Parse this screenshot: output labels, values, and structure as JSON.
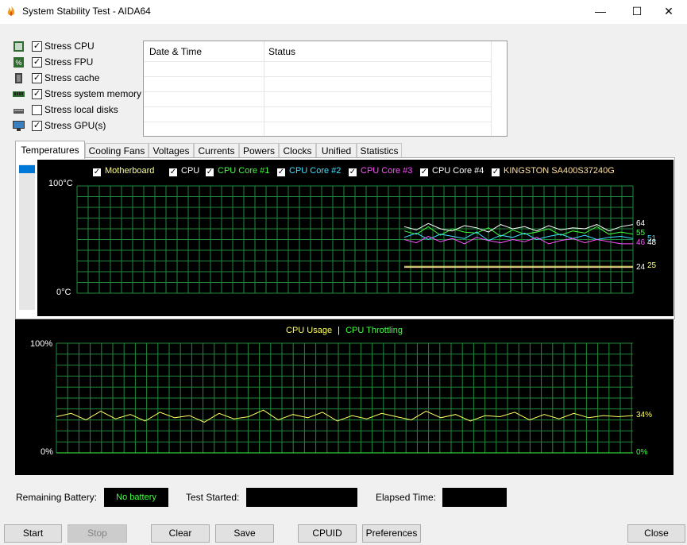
{
  "window": {
    "title": "System Stability Test - AIDA64",
    "minimize": "—",
    "maximize": "☐",
    "close": "✕"
  },
  "stress_options": [
    {
      "label": "Stress CPU",
      "checked": true,
      "icon": "cpu-chip-icon"
    },
    {
      "label": "Stress FPU",
      "checked": true,
      "icon": "fpu-icon"
    },
    {
      "label": "Stress cache",
      "checked": true,
      "icon": "cache-icon"
    },
    {
      "label": "Stress system memory",
      "checked": true,
      "icon": "memory-icon"
    },
    {
      "label": "Stress local disks",
      "checked": false,
      "icon": "disk-icon"
    },
    {
      "label": "Stress GPU(s)",
      "checked": true,
      "icon": "monitor-icon"
    }
  ],
  "log": {
    "col_date": "Date & Time",
    "col_status": "Status",
    "rows": []
  },
  "tabs": [
    "Temperatures",
    "Cooling Fans",
    "Voltages",
    "Currents",
    "Powers",
    "Clocks",
    "Unified",
    "Statistics"
  ],
  "active_tab": "Temperatures",
  "temperature_graph": {
    "legend": [
      {
        "label": "Motherboard",
        "color": "#ffff80",
        "checked": true
      },
      {
        "label": "CPU",
        "color": "#ffffff",
        "checked": true
      },
      {
        "label": "CPU Core #1",
        "color": "#40ff40",
        "checked": true
      },
      {
        "label": "CPU Core #2",
        "color": "#40e0ff",
        "checked": true
      },
      {
        "label": "CPU Core #3",
        "color": "#ff50ff",
        "checked": true
      },
      {
        "label": "CPU Core #4",
        "color": "#ffffff",
        "checked": true
      },
      {
        "label": "KINGSTON SA400S37240G",
        "color": "#ffe0a0",
        "checked": true
      }
    ],
    "y_max_label": "100°C",
    "y_min_label": "0°C",
    "current_values": [
      {
        "text": "64",
        "color": "#ffffff"
      },
      {
        "text": "55",
        "color": "#40ff40"
      },
      {
        "text": "51",
        "color": "#40e0ff"
      },
      {
        "text": "48",
        "color": "#ffffff"
      },
      {
        "text": "46",
        "color": "#ff50ff"
      },
      {
        "text": "24",
        "color": "#ffffff"
      },
      {
        "text": "25",
        "color": "#ffff80"
      }
    ]
  },
  "cpu_graph": {
    "title_usage": "CPU Usage",
    "separator": "|",
    "title_throttling": "CPU Throttling",
    "usage_color": "#ffff60",
    "throttling_color": "#40ff40",
    "y_max_label": "100%",
    "y_min_label": "0%",
    "current_usage": "34%",
    "current_throttling": "0%"
  },
  "chart_data": [
    {
      "type": "line",
      "title": "Temperatures",
      "ylim": [
        0,
        100
      ],
      "unit": "°C",
      "series": [
        {
          "name": "CPU Core #1",
          "values": [
            58,
            55,
            62,
            54,
            60,
            57,
            56,
            61,
            53,
            59,
            55,
            57,
            60,
            54,
            58,
            56,
            62,
            55,
            57,
            55
          ]
        },
        {
          "name": "CPU Core #2",
          "values": [
            52,
            56,
            50,
            55,
            53,
            51,
            57,
            49,
            54,
            52,
            56,
            50,
            53,
            55,
            51,
            54,
            50,
            52,
            53,
            51
          ]
        },
        {
          "name": "CPU Core #3",
          "values": [
            50,
            47,
            53,
            48,
            51,
            46,
            52,
            49,
            47,
            50,
            48,
            52,
            46,
            49,
            51,
            47,
            50,
            48,
            46,
            46
          ]
        },
        {
          "name": "CPU",
          "values": [
            62,
            59,
            65,
            60,
            58,
            63,
            61,
            57,
            64,
            60,
            62,
            58,
            63,
            59,
            61,
            60,
            64,
            58,
            62,
            64
          ]
        },
        {
          "name": "Motherboard",
          "values": [
            25,
            25,
            25,
            25,
            25,
            25,
            25,
            25,
            25,
            25,
            25,
            25,
            25,
            25,
            25,
            25,
            25,
            25,
            25,
            25
          ]
        },
        {
          "name": "KINGSTON SA400S37240G",
          "values": [
            24,
            24,
            24,
            24,
            24,
            24,
            24,
            24,
            24,
            24,
            24,
            24,
            24,
            24,
            24,
            24,
            24,
            24,
            24,
            24
          ]
        }
      ]
    },
    {
      "type": "line",
      "title": "CPU Usage | CPU Throttling",
      "ylim": [
        0,
        100
      ],
      "unit": "%",
      "series": [
        {
          "name": "CPU Usage",
          "values": [
            33,
            36,
            30,
            38,
            31,
            35,
            29,
            37,
            32,
            34,
            28,
            36,
            31,
            33,
            39,
            30,
            35,
            32,
            37,
            29,
            34,
            31,
            36,
            33,
            30,
            38,
            32,
            35,
            29,
            34,
            33,
            37,
            30,
            35,
            31,
            36,
            32,
            34,
            33,
            34
          ]
        },
        {
          "name": "CPU Throttling",
          "values": [
            0,
            0,
            0,
            0,
            0,
            0,
            0,
            0,
            0,
            0,
            0,
            0,
            0,
            0,
            0,
            0,
            0,
            0,
            0,
            0,
            0,
            0,
            0,
            0,
            0,
            0,
            0,
            0,
            0,
            0,
            0,
            0,
            0,
            0,
            0,
            0,
            0,
            0,
            0,
            0
          ]
        }
      ]
    }
  ],
  "status_bar": {
    "battery_label": "Remaining Battery:",
    "battery_value": "No battery",
    "test_started_label": "Test Started:",
    "test_started_value": "",
    "elapsed_label": "Elapsed Time:",
    "elapsed_value": ""
  },
  "buttons": {
    "start": "Start",
    "stop": "Stop",
    "clear": "Clear",
    "save": "Save",
    "cpuid": "CPUID",
    "preferences": "Preferences",
    "close": "Close"
  }
}
